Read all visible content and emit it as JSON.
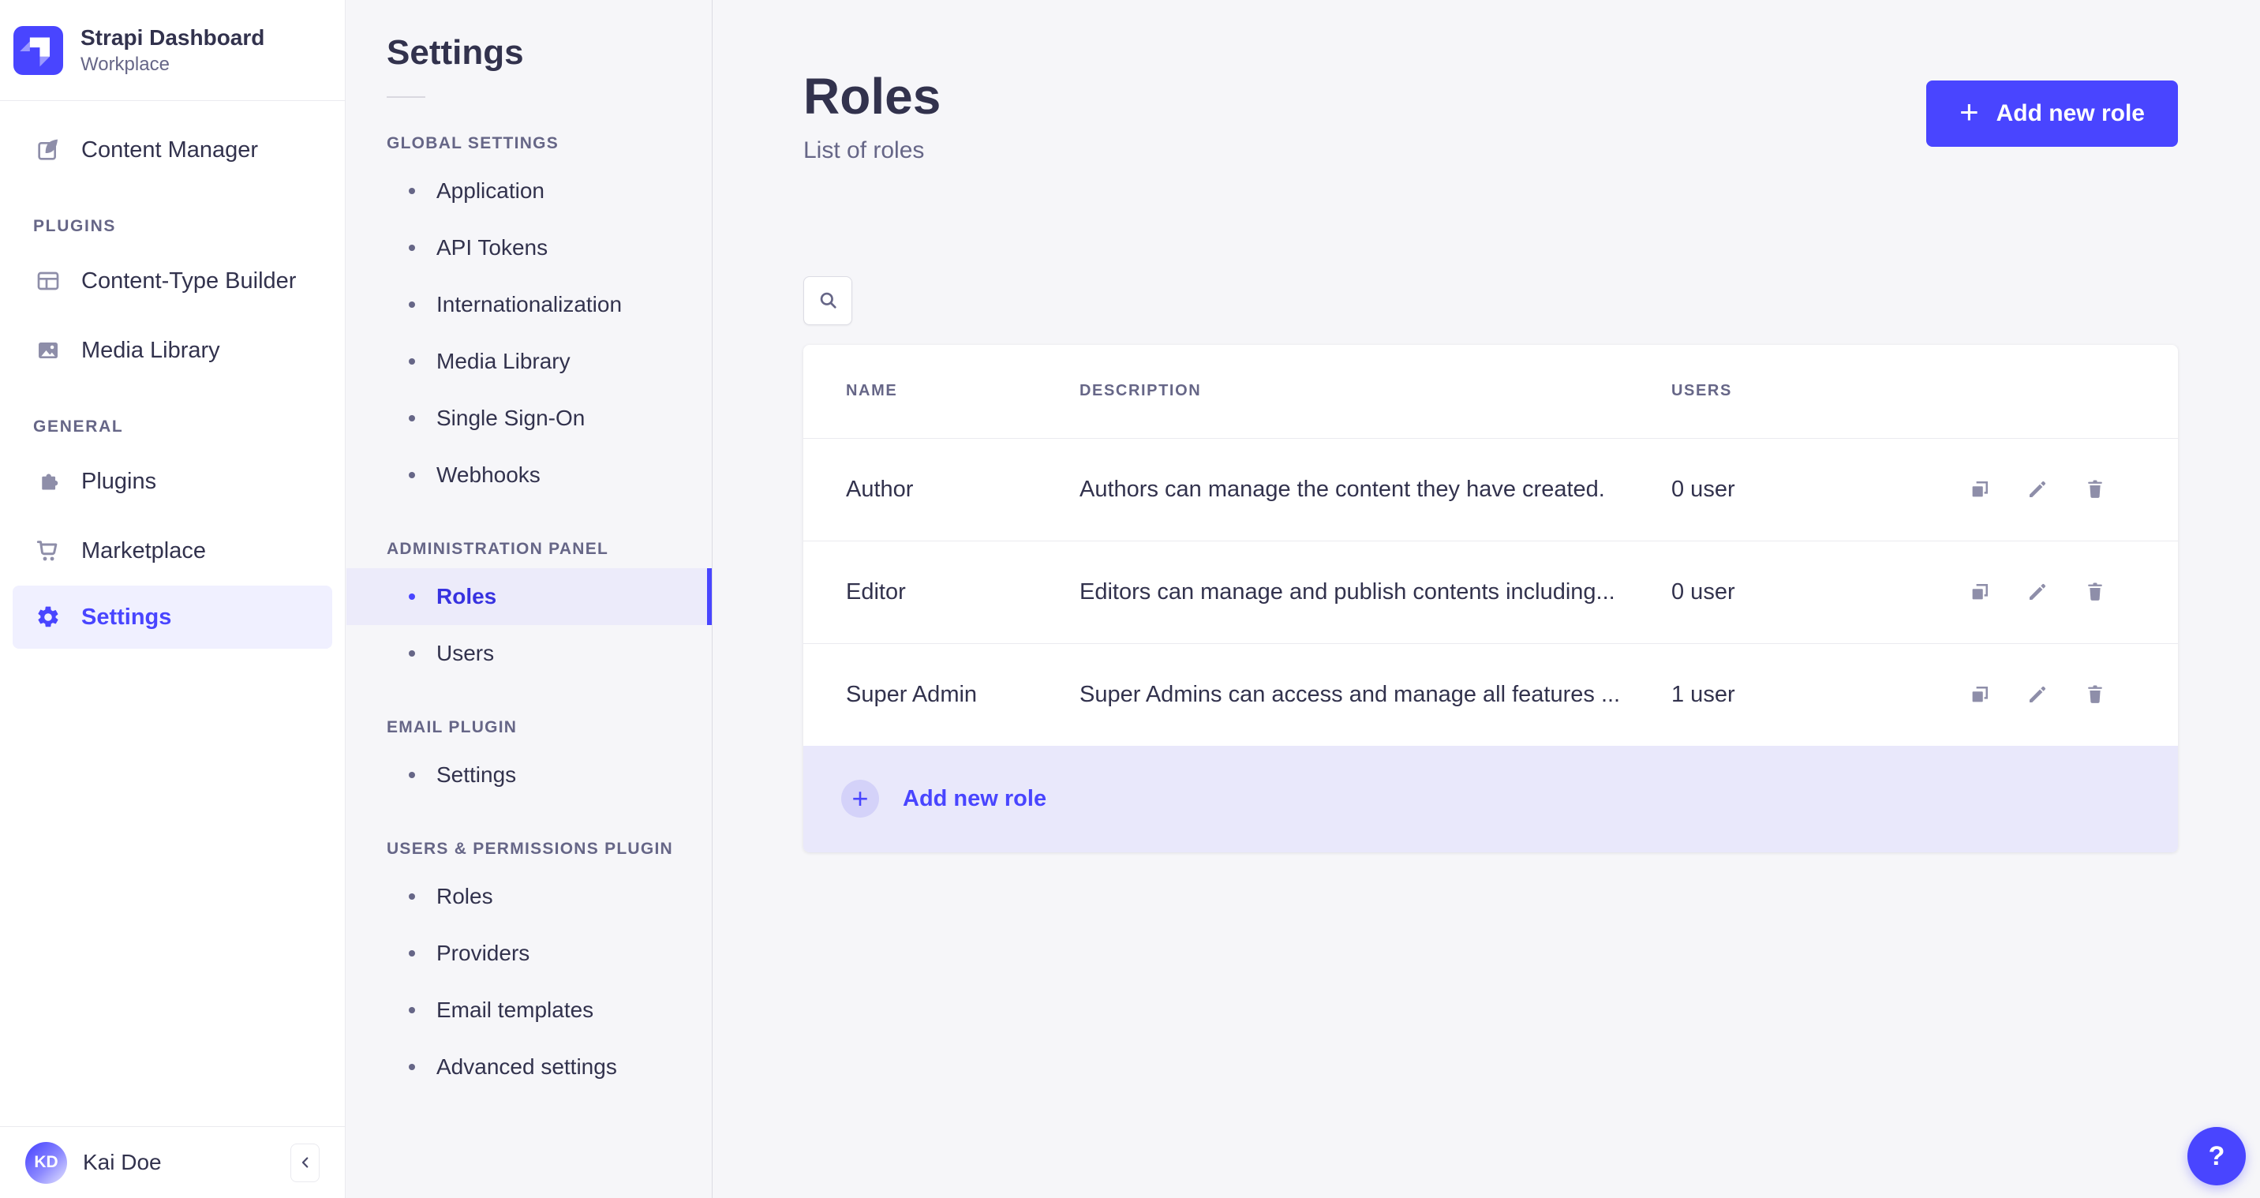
{
  "app": {
    "title": "Strapi Dashboard",
    "workspace": "Workplace"
  },
  "sidebar": {
    "content_manager": "Content Manager",
    "sections": [
      {
        "label": "PLUGINS",
        "items": [
          "Content-Type Builder",
          "Media Library"
        ]
      },
      {
        "label": "GENERAL",
        "items": [
          "Plugins",
          "Marketplace",
          "Settings"
        ]
      }
    ],
    "user": {
      "initials": "KD",
      "name": "Kai Doe"
    }
  },
  "subnav": {
    "title": "Settings",
    "sections": [
      {
        "label": "GLOBAL SETTINGS",
        "items": [
          "Application",
          "API Tokens",
          "Internationalization",
          "Media Library",
          "Single Sign-On",
          "Webhooks"
        ]
      },
      {
        "label": "ADMINISTRATION PANEL",
        "items": [
          "Roles",
          "Users"
        ]
      },
      {
        "label": "EMAIL PLUGIN",
        "items": [
          "Settings"
        ]
      },
      {
        "label": "USERS & PERMISSIONS PLUGIN",
        "items": [
          "Roles",
          "Providers",
          "Email templates",
          "Advanced settings"
        ]
      }
    ]
  },
  "page": {
    "title": "Roles",
    "subtitle": "List of roles",
    "add_button_label": "Add new role",
    "add_row_label": "Add new role",
    "table": {
      "headers": {
        "name": "NAME",
        "description": "DESCRIPTION",
        "users": "USERS"
      },
      "rows": [
        {
          "name": "Author",
          "description": "Authors can manage the content they have created.",
          "users": "0 user"
        },
        {
          "name": "Editor",
          "description": "Editors can manage and publish contents including...",
          "users": "0 user"
        },
        {
          "name": "Super Admin",
          "description": "Super Admins can access and manage all features ...",
          "users": "1 user"
        }
      ]
    }
  },
  "icons": {
    "plus": "+",
    "question": "?"
  },
  "colors": {
    "primary": "#4945ff",
    "primary_light": "#f0f0ff",
    "active_row_bg": "#ecebfa",
    "footer_row_bg": "#e9e8fb",
    "text_dark": "#32324d",
    "text_muted": "#666687",
    "icon_gray": "#8e8ea9",
    "border": "#eaeaef",
    "page_bg": "#f6f6f9"
  }
}
